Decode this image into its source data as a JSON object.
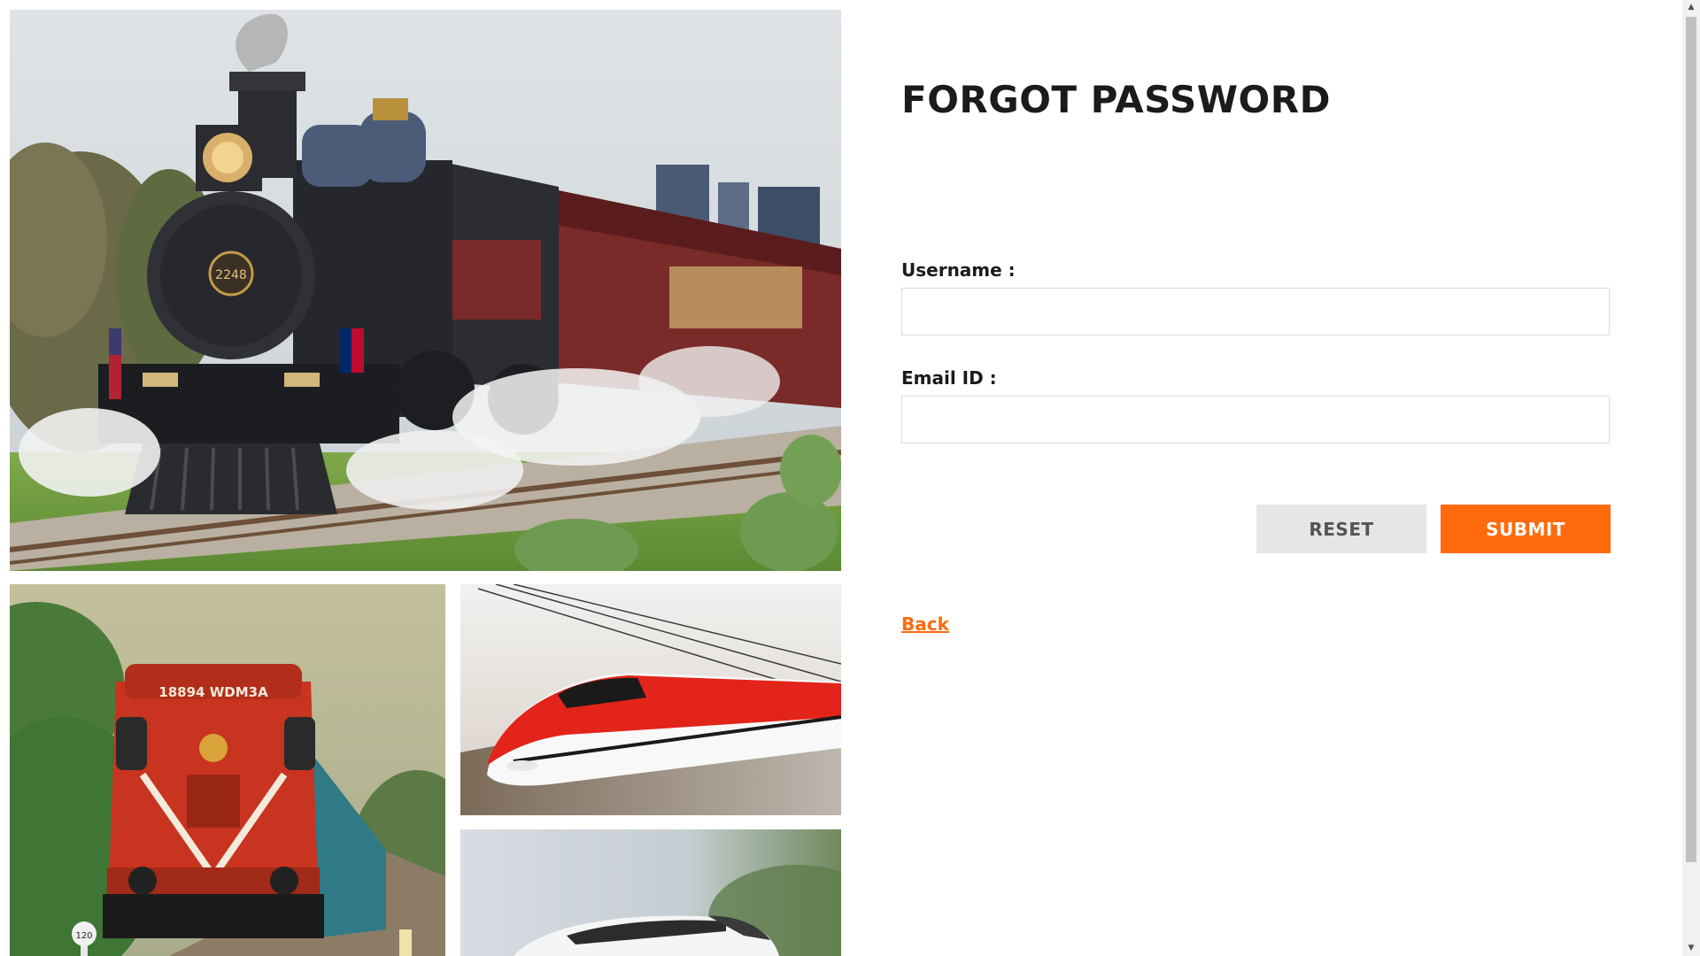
{
  "form": {
    "title": "FORGOT PASSWORD",
    "username_label": "Username :",
    "username_value": "",
    "email_label": "Email ID :",
    "email_value": "",
    "reset_label": "RESET",
    "submit_label": "SUBMIT",
    "back_label": "Back"
  },
  "images": {
    "main": "steam-locomotive-photo",
    "bottom_left": "red-diesel-locomotive-photo",
    "bottom_right_top": "red-high-speed-train-photo",
    "bottom_right_bottom": "white-high-speed-train-photo",
    "steam_number": "2248",
    "diesel_number": "18894 WDM3A",
    "post_number": "120"
  },
  "colors": {
    "accent": "#ff6a0d",
    "reset_bg": "#e6e6e6",
    "title": "#1b1b1b"
  },
  "scrollbar": {
    "up_icon": "scroll-up-arrow-icon",
    "down_icon": "scroll-down-arrow-icon"
  }
}
